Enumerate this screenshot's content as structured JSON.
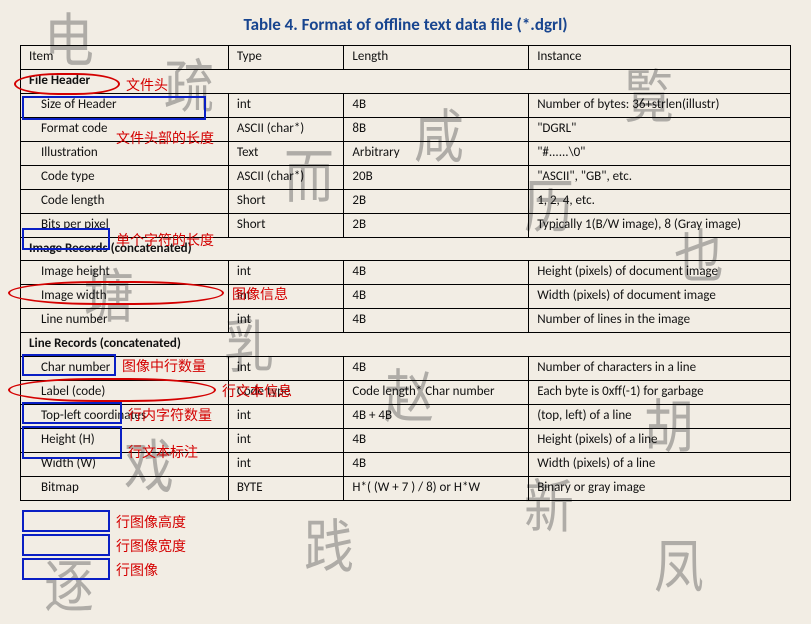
{
  "title": "Table 4. Format of offline text data file (*.dgrl)",
  "headers": {
    "item": "Item",
    "type": "Type",
    "length": "Length",
    "instance": "Instance"
  },
  "sections": {
    "file_header": "File Header",
    "image_records": "Image Records (concatenated)",
    "line_records": "Line Records (concatenated)"
  },
  "rows": {
    "size_of_header": {
      "item": "Size of Header",
      "type": "int",
      "length": "4B",
      "instance": "Number of bytes: 36+strlen(illustr)"
    },
    "format_code": {
      "item": "Format code",
      "type": "ASCII (char*)",
      "length": "8B",
      "instance": "\"DGRL\""
    },
    "illustration": {
      "item": "Illustration",
      "type": "Text",
      "length": "Arbitrary",
      "instance": "\"#......\\0\""
    },
    "code_type": {
      "item": "Code type",
      "type": "ASCII (char*)",
      "length": "20B",
      "instance": "\"ASCII\", \"GB\", etc."
    },
    "code_length": {
      "item": "Code length",
      "type": "Short",
      "length": "2B",
      "instance": "1, 2, 4, etc."
    },
    "bits_per_pixel": {
      "item": "Bits per pixel",
      "type": "Short",
      "length": "2B",
      "instance": "Typically 1(B/W image), 8 (Gray image)"
    },
    "image_height": {
      "item": "Image height",
      "type": "int",
      "length": "4B",
      "instance": "Height (pixels) of document image"
    },
    "image_width": {
      "item": "Image width",
      "type": "int",
      "length": "4B",
      "instance": "Width (pixels) of document image"
    },
    "line_number": {
      "item": "Line number",
      "type": "int",
      "length": "4B",
      "instance": "Number of lines in the image"
    },
    "char_number": {
      "item": "Char number",
      "type": "int",
      "length": "4B",
      "instance": "Number of characters in a line"
    },
    "label_code": {
      "item": "Label (code)",
      "type": "Code type",
      "length": "Code length* Char number",
      "instance": "Each byte is 0xff(-1) for garbage"
    },
    "top_left": {
      "item": "Top-left coordinates",
      "type": "int",
      "length": "4B + 4B",
      "instance": "(top, left) of a line"
    },
    "height_h": {
      "item": "Height (H)",
      "type": "int",
      "length": "4B",
      "instance": "Height (pixels) of a line"
    },
    "width_w": {
      "item": "Width (W)",
      "type": "int",
      "length": "4B",
      "instance": "Width (pixels) of a line"
    },
    "bitmap": {
      "item": "Bitmap",
      "type": "BYTE",
      "length": "H*( (W + 7 ) / 8) or H*W",
      "instance": "Binary or gray image"
    }
  },
  "annotations": {
    "file_header_note": "文件头",
    "header_len_note": "文件头部的长度",
    "single_char_len_note": "单个字符的长度",
    "image_info_note": "图像信息",
    "line_count_note": "图像中行数量",
    "line_text_info_note": "行文本信息",
    "line_char_count_note": "行内字符数量",
    "line_label_note": "行文本标注",
    "line_img_h_note": "行图像高度",
    "line_img_w_note": "行图像宽度",
    "line_img_note": "行图像"
  },
  "chart_data": {
    "type": "table",
    "title": "Table 4. Format of offline text data file (*.dgrl)",
    "columns": [
      "Item",
      "Type",
      "Length",
      "Instance"
    ],
    "rows": [
      [
        "File Header",
        "",
        "",
        ""
      ],
      [
        "Size of Header",
        "int",
        "4B",
        "Number of bytes: 36+strlen(illustr)"
      ],
      [
        "Format code",
        "ASCII (char*)",
        "8B",
        "\"DGRL\""
      ],
      [
        "Illustration",
        "Text",
        "Arbitrary",
        "\"#......\\0\""
      ],
      [
        "Code type",
        "ASCII (char*)",
        "20B",
        "\"ASCII\", \"GB\", etc."
      ],
      [
        "Code length",
        "Short",
        "2B",
        "1, 2, 4, etc."
      ],
      [
        "Bits per pixel",
        "Short",
        "2B",
        "Typically 1(B/W image), 8 (Gray image)"
      ],
      [
        "Image Records (concatenated)",
        "",
        "",
        ""
      ],
      [
        "Image height",
        "int",
        "4B",
        "Height (pixels) of document image"
      ],
      [
        "Image width",
        "int",
        "4B",
        "Width (pixels) of document image"
      ],
      [
        "Line number",
        "int",
        "4B",
        "Number of lines in the image"
      ],
      [
        "Line Records (concatenated)",
        "",
        "",
        ""
      ],
      [
        "Char number",
        "int",
        "4B",
        "Number of characters in a line"
      ],
      [
        "Label (code)",
        "Code type",
        "Code length* Char number",
        "Each byte is 0xff(-1) for garbage"
      ],
      [
        "Top-left coordinates",
        "int",
        "4B + 4B",
        "(top, left) of a line"
      ],
      [
        "Height (H)",
        "int",
        "4B",
        "Height (pixels) of a line"
      ],
      [
        "Width (W)",
        "int",
        "4B",
        "Width (pixels) of a line"
      ],
      [
        "Bitmap",
        "BYTE",
        "H*( (W + 7 ) / 8) or H*W",
        "Binary or gray image"
      ]
    ]
  }
}
